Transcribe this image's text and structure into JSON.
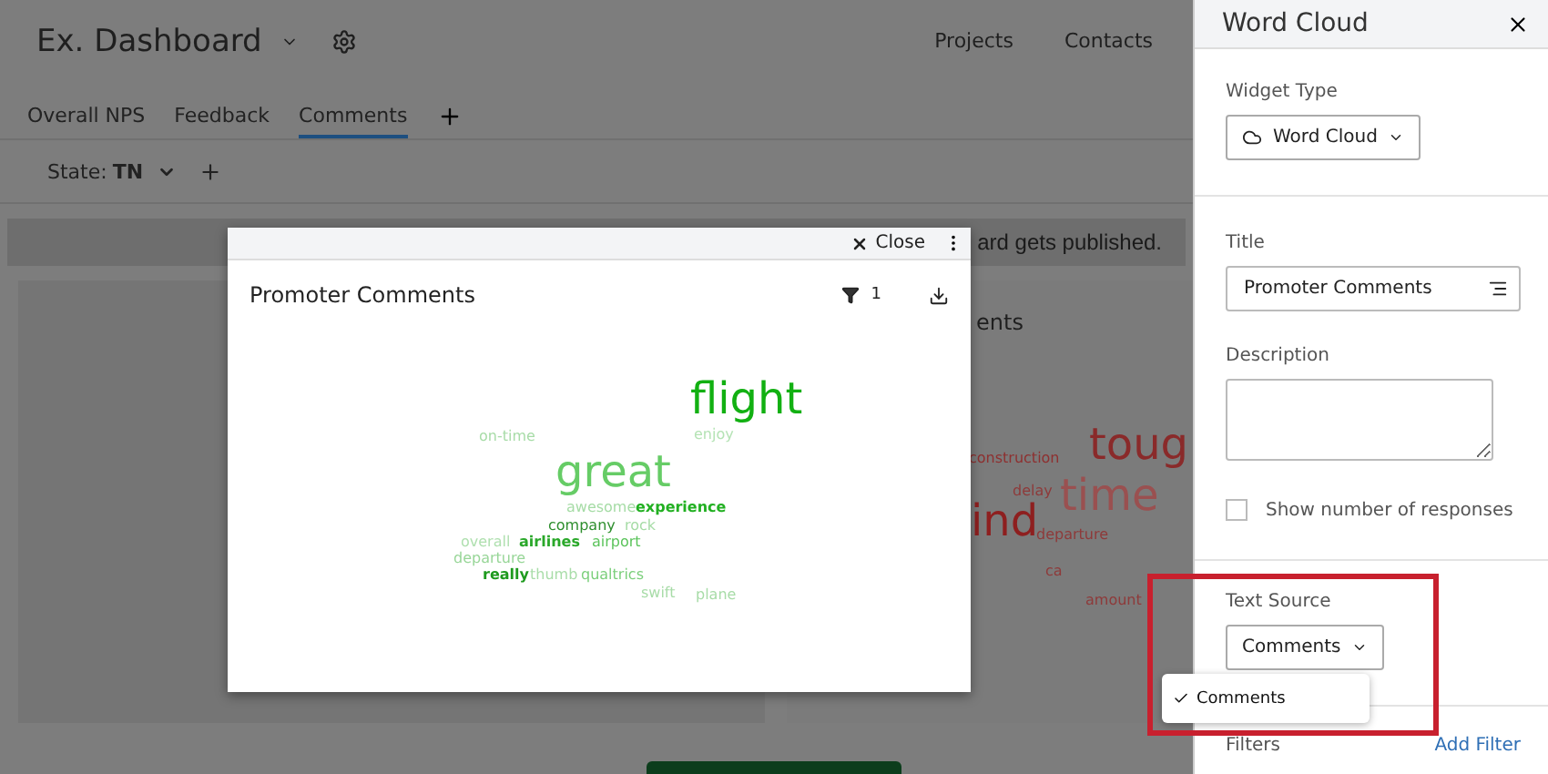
{
  "header": {
    "title": "Ex. Dashboard",
    "nav": [
      "Projects",
      "Contacts"
    ]
  },
  "tabs": [
    {
      "label": "Overall NPS",
      "selected": false
    },
    {
      "label": "Feedback",
      "selected": false
    },
    {
      "label": "Comments",
      "selected": true
    }
  ],
  "filter": {
    "label": "State:",
    "value": "TN"
  },
  "banner": {
    "text": "ard gets published."
  },
  "background_card": {
    "title": "ents",
    "words": [
      {
        "text": "construction",
        "kind": "small",
        "color": "#8e3030"
      },
      {
        "text": "toug",
        "kind": "big",
        "color": "#8a2a2a"
      },
      {
        "text": "time",
        "kind": "big",
        "color": "#9a5050"
      },
      {
        "text": "delay",
        "kind": "small",
        "color": "#8e3a3a"
      },
      {
        "text": "ind",
        "kind": "big",
        "color": "#8e1f1f"
      },
      {
        "text": "departure",
        "kind": "small",
        "color": "#8e3a3a"
      },
      {
        "text": "ca",
        "kind": "small",
        "color": "#8e3a3a"
      },
      {
        "text": "amount",
        "kind": "small",
        "color": "#8e3a3a"
      }
    ]
  },
  "modal": {
    "close": "Close",
    "title": "Promoter Comments",
    "filter_count": "1",
    "words": [
      {
        "text": "flight",
        "kind": "big",
        "color": "#12b012"
      },
      {
        "text": "on-time",
        "kind": "small",
        "color": "#a8dca8"
      },
      {
        "text": "enjoy",
        "kind": "small",
        "color": "#b5e3b5"
      },
      {
        "text": "great",
        "kind": "big",
        "color": "#66cc66"
      },
      {
        "text": "awesome",
        "kind": "small",
        "color": "#a6dca6"
      },
      {
        "text": "experience",
        "kind": "bold",
        "color": "#22b022"
      },
      {
        "text": "company",
        "kind": "small",
        "color": "#2f8f2f"
      },
      {
        "text": "rock",
        "kind": "small",
        "color": "#a6dca6"
      },
      {
        "text": "overall",
        "kind": "small",
        "color": "#b0e0b0"
      },
      {
        "text": "airlines",
        "kind": "bold",
        "color": "#2aa82a"
      },
      {
        "text": "airport",
        "kind": "small",
        "color": "#5cc45c"
      },
      {
        "text": "departure",
        "kind": "small",
        "color": "#98d698"
      },
      {
        "text": "really",
        "kind": "bold",
        "color": "#1e9a1e"
      },
      {
        "text": "thumb",
        "kind": "small",
        "color": "#a9dda9"
      },
      {
        "text": "qualtrics",
        "kind": "small",
        "color": "#7ccf7c"
      },
      {
        "text": "swift",
        "kind": "small",
        "color": "#a8dca8"
      },
      {
        "text": "plane",
        "kind": "small",
        "color": "#a8dca8"
      }
    ]
  },
  "panel": {
    "title": "Word Cloud",
    "widget_type_label": "Widget Type",
    "widget_type": "Word Cloud",
    "title_label": "Title",
    "title_value": "Promoter Comments",
    "description_label": "Description",
    "show_responses": {
      "label": "Show number of responses",
      "checked": false
    },
    "text_source_label": "Text Source",
    "text_source": "Comments",
    "menu": [
      {
        "label": "Comments",
        "selected": true
      }
    ],
    "filters_label": "Filters",
    "add_filter": "Add Filter"
  }
}
